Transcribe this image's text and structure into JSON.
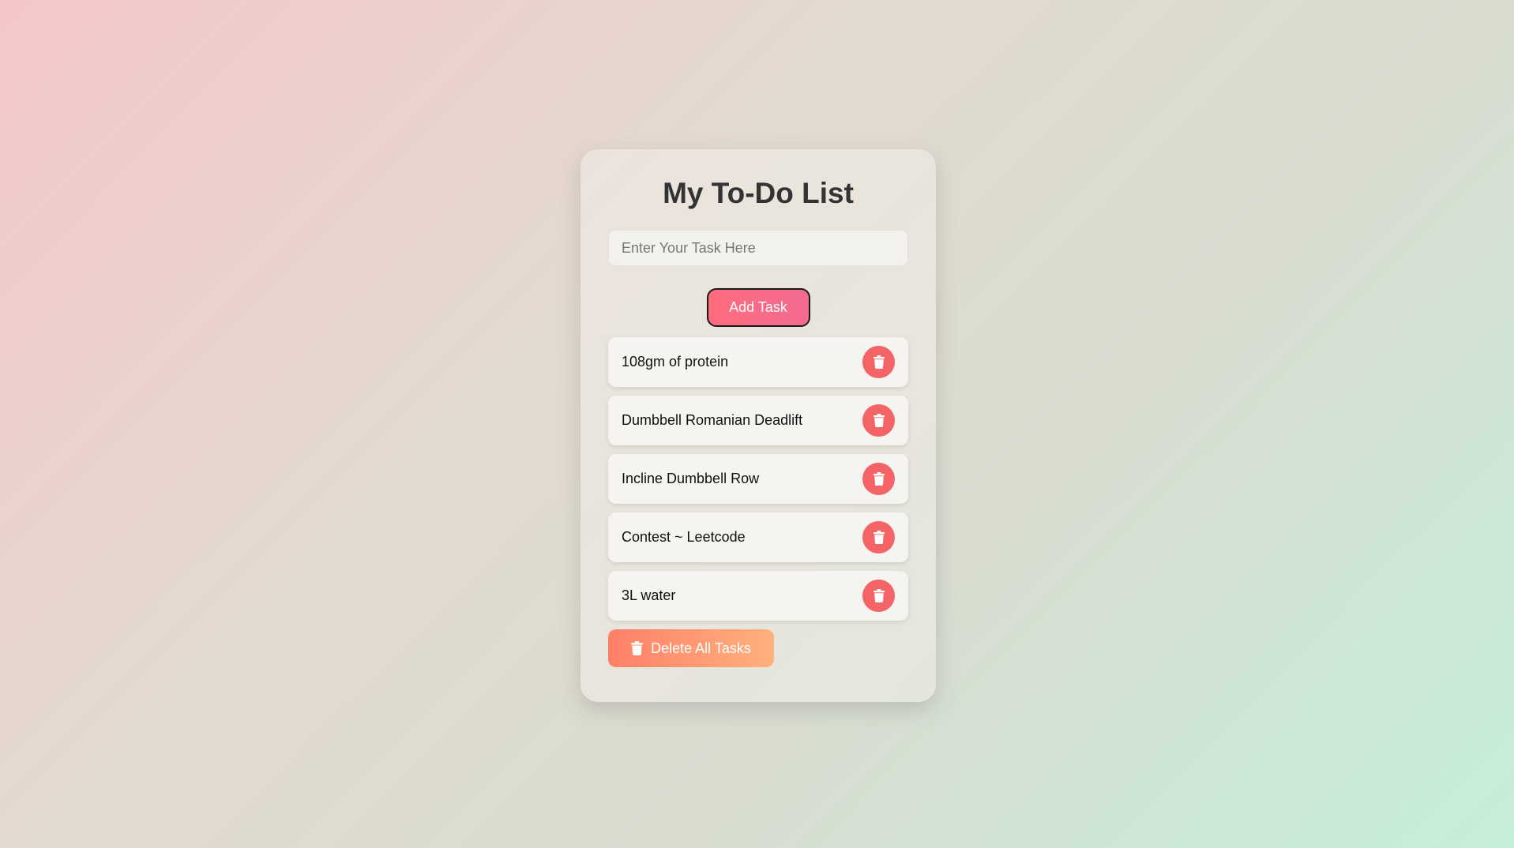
{
  "header": {
    "title": "My To-Do List"
  },
  "input": {
    "placeholder": "Enter Your Task Here",
    "value": ""
  },
  "buttons": {
    "add_label": "Add Task",
    "delete_all_label": "Delete All Tasks"
  },
  "tasks": [
    {
      "text": "108gm of protein"
    },
    {
      "text": "Dumbbell Romanian Deadlift"
    },
    {
      "text": "Incline Dumbbell Row"
    },
    {
      "text": "Contest ~ Leetcode"
    },
    {
      "text": "3L water"
    }
  ],
  "icons": {
    "task_delete": "trash-icon",
    "delete_all": "trash-icon"
  },
  "colors": {
    "add_button": "#ff6b7d",
    "delete_button": "#f46467",
    "delete_all_start": "#ff8068",
    "delete_all_end": "#ffb17d",
    "title": "#333333"
  }
}
